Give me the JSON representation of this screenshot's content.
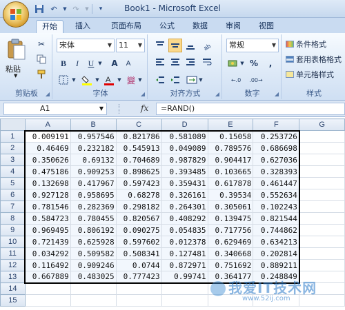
{
  "window": {
    "title": "Book1 - Microsoft Excel"
  },
  "ribbon_tabs": [
    "开始",
    "插入",
    "页面布局",
    "公式",
    "数据",
    "审阅",
    "视图"
  ],
  "active_tab": "开始",
  "groups": {
    "clipboard": {
      "label": "剪贴板",
      "paste_label": "粘贴"
    },
    "font": {
      "label": "字体",
      "font_name": "宋体",
      "font_size": "11",
      "bold": "B",
      "italic": "I",
      "underline": "U",
      "grow": "A",
      "shrink": "A",
      "phonetic": "變"
    },
    "alignment": {
      "label": "对齐方式"
    },
    "number": {
      "label": "数字",
      "format": "常规"
    },
    "styles": {
      "label": "样式",
      "conditional": "条件格式",
      "table": "套用表格格式",
      "cell": "单元格样式"
    }
  },
  "formula_bar": {
    "name_box": "A1",
    "fx": "fx",
    "formula": "=RAND()"
  },
  "sheet": {
    "columns": [
      "A",
      "B",
      "C",
      "D",
      "E",
      "F",
      "G"
    ],
    "rows": [
      {
        "n": "1",
        "cells": [
          "0.009191",
          "0.957546",
          "0.821786",
          "0.581089",
          "0.15058",
          "0.253726"
        ]
      },
      {
        "n": "2",
        "cells": [
          "0.46469",
          "0.232182",
          "0.545913",
          "0.049089",
          "0.789576",
          "0.686698"
        ]
      },
      {
        "n": "3",
        "cells": [
          "0.350626",
          "0.69132",
          "0.704689",
          "0.987829",
          "0.904417",
          "0.627036"
        ]
      },
      {
        "n": "4",
        "cells": [
          "0.475186",
          "0.909253",
          "0.898625",
          "0.393485",
          "0.103665",
          "0.328393"
        ]
      },
      {
        "n": "5",
        "cells": [
          "0.132698",
          "0.417967",
          "0.597423",
          "0.359431",
          "0.617878",
          "0.461447"
        ]
      },
      {
        "n": "6",
        "cells": [
          "0.927128",
          "0.958695",
          "0.68278",
          "0.326161",
          "0.39534",
          "0.552634"
        ]
      },
      {
        "n": "7",
        "cells": [
          "0.781546",
          "0.282369",
          "0.298182",
          "0.264301",
          "0.305061",
          "0.102243"
        ]
      },
      {
        "n": "8",
        "cells": [
          "0.584723",
          "0.780455",
          "0.820567",
          "0.408292",
          "0.139475",
          "0.821544"
        ]
      },
      {
        "n": "9",
        "cells": [
          "0.969495",
          "0.806192",
          "0.090275",
          "0.054835",
          "0.717756",
          "0.744862"
        ]
      },
      {
        "n": "10",
        "cells": [
          "0.721439",
          "0.625928",
          "0.597602",
          "0.012378",
          "0.629469",
          "0.634213"
        ]
      },
      {
        "n": "11",
        "cells": [
          "0.034292",
          "0.509582",
          "0.508341",
          "0.127481",
          "0.340668",
          "0.202814"
        ]
      },
      {
        "n": "12",
        "cells": [
          "0.116492",
          "0.909246",
          "0.0744",
          "0.872971",
          "0.751692",
          "0.889211"
        ]
      },
      {
        "n": "13",
        "cells": [
          "0.667889",
          "0.483025",
          "0.777423",
          "0.99741",
          "0.364177",
          "0.248849"
        ]
      },
      {
        "n": "14",
        "cells": [
          "",
          "",
          "",
          "",
          "",
          ""
        ]
      },
      {
        "n": "15",
        "cells": [
          "",
          "",
          "",
          "",
          "",
          ""
        ]
      }
    ]
  },
  "watermark": {
    "main": "我爱IT技术网",
    "sub": "www.52ij.com"
  },
  "colors": {
    "ribbon_bg": "#dde9f7",
    "selection_border": "#000000",
    "selection_fill": "#f2f7fd",
    "header_bg": "#dbe5f2"
  }
}
